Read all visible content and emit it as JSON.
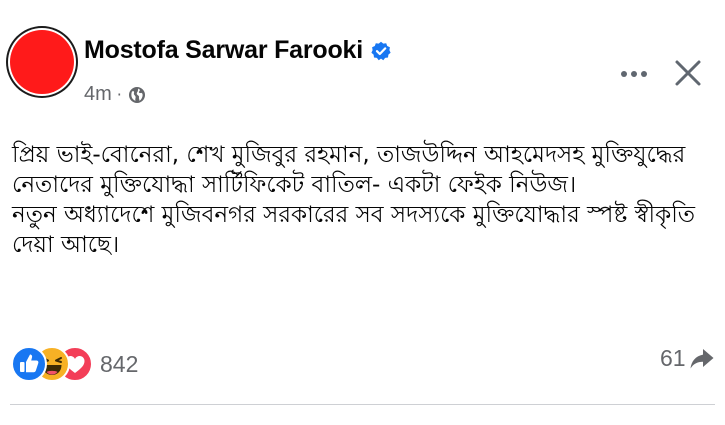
{
  "post": {
    "author": "Mostofa Sarwar Farooki",
    "time": "4m",
    "separator": "·",
    "audience_icon": "globe-icon",
    "verified_icon": "verified-badge-icon",
    "text_lines": [
      "প্রিয় ভাই-বোনেরা, শেখ মুজিবুর রহমান, তাজউদ্দিন আহমেদসহ মুক্তিযুদ্ধের",
      "নেতাদের মুক্তিযোদ্ধা সার্টিফিকেট বাতিল- একটা ফেইক নিউজ।",
      "নতুন অধ্যাদেশে মুজিবনগর সরকারের সব সদস্যকে মুক্তিযোদ্ধার স্পষ্ট স্বীকৃতি",
      "দেয়া আছে।"
    ],
    "reaction_icons": [
      "like-icon",
      "haha-icon",
      "love-icon"
    ],
    "reaction_count": "842",
    "share_count": "61",
    "colors": {
      "avatar": "#ff1a1a",
      "verified": "#1877f2",
      "secondary_text": "#65676b"
    }
  }
}
